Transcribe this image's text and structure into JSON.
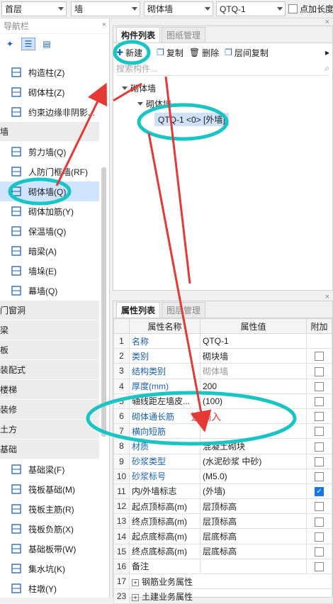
{
  "toolbar": {
    "floor": "首层",
    "type": "墙",
    "subtype": "砌体墙",
    "component": "QTQ-1",
    "checkbox_label": "点加长度"
  },
  "nav": {
    "title": "导航栏",
    "close": "×",
    "items_top": [
      {
        "label": "构造柱(Z)",
        "icon": "column-icon"
      },
      {
        "label": "砌体柱(Z)",
        "icon": "masonry-column-icon"
      },
      {
        "label": "约束边缘非阴影...",
        "icon": "edge-constraint-icon"
      }
    ],
    "wall_category": "墙",
    "wall_items": [
      {
        "label": "剪力墙(Q)",
        "icon": "shear-wall-icon"
      },
      {
        "label": "人防门框墙(RF)",
        "icon": "door-frame-wall-icon"
      },
      {
        "label": "砌体墙(Q)",
        "icon": "masonry-wall-icon"
      },
      {
        "label": "砌体加筋(Y)",
        "icon": "masonry-rebar-icon"
      },
      {
        "label": "保温墙(Q)",
        "icon": "insulation-wall-icon"
      },
      {
        "label": "暗梁(A)",
        "icon": "hidden-beam-icon"
      },
      {
        "label": "墙垛(E)",
        "icon": "wall-pier-icon"
      },
      {
        "label": "幕墙(Q)",
        "icon": "curtain-wall-icon"
      }
    ],
    "categories": [
      "门窗洞",
      "梁",
      "板",
      "装配式",
      "楼梯",
      "装修",
      "土方"
    ],
    "foundation_category": "基础",
    "foundation_items": [
      {
        "label": "基础梁(F)",
        "icon": "foundation-beam-icon"
      },
      {
        "label": "筏板基础(M)",
        "icon": "raft-foundation-icon"
      },
      {
        "label": "筏板主筋(R)",
        "icon": "raft-main-rebar-icon"
      },
      {
        "label": "筏板负筋(X)",
        "icon": "raft-neg-rebar-icon"
      },
      {
        "label": "基础板带(W)",
        "icon": "foundation-strip-icon"
      },
      {
        "label": "集水坑(K)",
        "icon": "sump-pit-icon"
      },
      {
        "label": "柱墩(Y)",
        "icon": "column-pier-icon"
      }
    ]
  },
  "component_panel": {
    "tabs": [
      "构件列表",
      "图纸管理"
    ],
    "actions": {
      "new": "新建",
      "copy": "复制",
      "delete": "删除",
      "floor_copy": "层间复制"
    },
    "search_placeholder": "搜索构件...",
    "tree": {
      "root": "砌体墙",
      "child": "砌体墙",
      "leaf": "QTQ-1 <0> [外墙]"
    }
  },
  "property_panel": {
    "tabs": [
      "属性列表",
      "图层管理"
    ],
    "headers": [
      "属性名称",
      "属性值",
      "附加"
    ],
    "rows": [
      {
        "n": "1",
        "name": "名称",
        "value": "QTQ-1",
        "blue": true,
        "cb": "none"
      },
      {
        "n": "2",
        "name": "类别",
        "value": "砌块墙",
        "blue": true,
        "cb": "off"
      },
      {
        "n": "3",
        "name": "结构类别",
        "value": "砌体墙",
        "blue": true,
        "cb": "off",
        "gray": true
      },
      {
        "n": "4",
        "name": "厚度(mm)",
        "value": "200",
        "blue": true,
        "cb": "off"
      },
      {
        "n": "5",
        "name": "轴线距左墙皮...",
        "value": "(100)",
        "blue": false,
        "cb": "off"
      },
      {
        "n": "6",
        "name": "砌体通长筋",
        "value": "",
        "blue": true,
        "cb": "off"
      },
      {
        "n": "7",
        "name": "横向短筋",
        "value": "",
        "blue": true,
        "cb": "off"
      },
      {
        "n": "8",
        "name": "材质",
        "value": "混凝土砌块",
        "blue": true,
        "cb": "off"
      },
      {
        "n": "9",
        "name": "砂浆类型",
        "value": "(水泥砂浆 中砂)",
        "blue": true,
        "cb": "off"
      },
      {
        "n": "10",
        "name": "砂浆标号",
        "value": "(M5.0)",
        "blue": true,
        "cb": "off"
      },
      {
        "n": "11",
        "name": "内/外墙标志",
        "value": "(外墙)",
        "blue": false,
        "cb": "on"
      },
      {
        "n": "12",
        "name": "起点顶标高(m)",
        "value": "层顶标高",
        "blue": false,
        "cb": "off"
      },
      {
        "n": "13",
        "name": "终点顶标高(m)",
        "value": "层顶标高",
        "blue": false,
        "cb": "off"
      },
      {
        "n": "14",
        "name": "起点底标高(m)",
        "value": "层底标高",
        "blue": false,
        "cb": "off"
      },
      {
        "n": "15",
        "name": "终点底标高(m)",
        "value": "层底标高",
        "blue": false,
        "cb": "off"
      },
      {
        "n": "16",
        "name": "备注",
        "value": "",
        "blue": false,
        "cb": "off"
      },
      {
        "n": "17",
        "name": "钢筋业务属性",
        "value": "",
        "blue": false,
        "cb": "none",
        "group": true
      },
      {
        "n": "23",
        "name": "土建业务属性",
        "value": "",
        "blue": false,
        "cb": "none",
        "group": true
      }
    ]
  },
  "annotation": {
    "text": "这输入",
    "color": "#e53935",
    "circle_color": "#19c4c4"
  }
}
